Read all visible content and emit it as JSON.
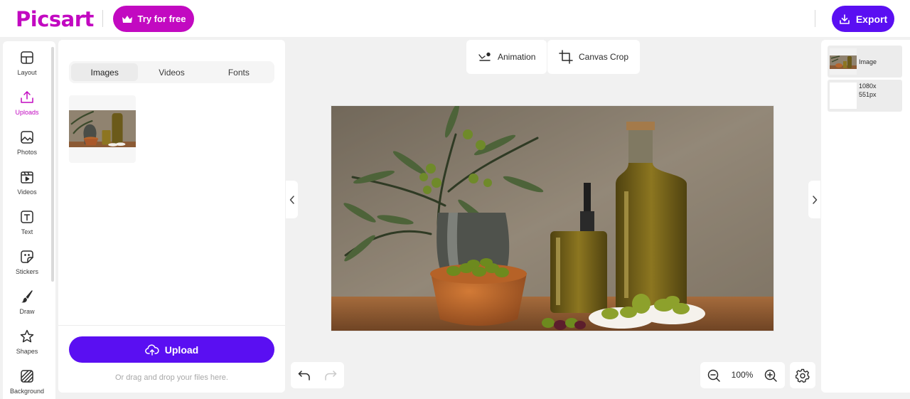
{
  "header": {
    "logo": "Picsart",
    "try_label": "Try for free",
    "export_label": "Export"
  },
  "leftnav": {
    "items": [
      {
        "label": "Layout",
        "icon": "layout-icon",
        "active": false
      },
      {
        "label": "Uploads",
        "icon": "upload-icon",
        "active": true
      },
      {
        "label": "Photos",
        "icon": "photo-icon",
        "active": false
      },
      {
        "label": "Videos",
        "icon": "video-icon",
        "active": false
      },
      {
        "label": "Text",
        "icon": "text-icon",
        "active": false
      },
      {
        "label": "Stickers",
        "icon": "sticker-icon",
        "active": false
      },
      {
        "label": "Draw",
        "icon": "brush-icon",
        "active": false
      },
      {
        "label": "Shapes",
        "icon": "star-icon",
        "active": false
      },
      {
        "label": "Background",
        "icon": "background-pattern-icon",
        "active": false
      }
    ]
  },
  "uploads": {
    "tabs": [
      "Images",
      "Videos",
      "Fonts"
    ],
    "active_tab": "Images",
    "upload_label": "Upload",
    "drop_hint": "Or drag and drop your files here."
  },
  "toolbar": {
    "animation_label": "Animation",
    "canvas_crop_label": "Canvas Crop"
  },
  "zoom": {
    "value": "100%"
  },
  "layers": {
    "items": [
      {
        "label": "Image"
      },
      {
        "label_line1": "1080x",
        "label_line2": "551px"
      }
    ]
  },
  "colors": {
    "brand_magenta": "#c209c1",
    "accent_purple": "#5a0ff2",
    "workspace_bg": "#f1f1f1"
  }
}
